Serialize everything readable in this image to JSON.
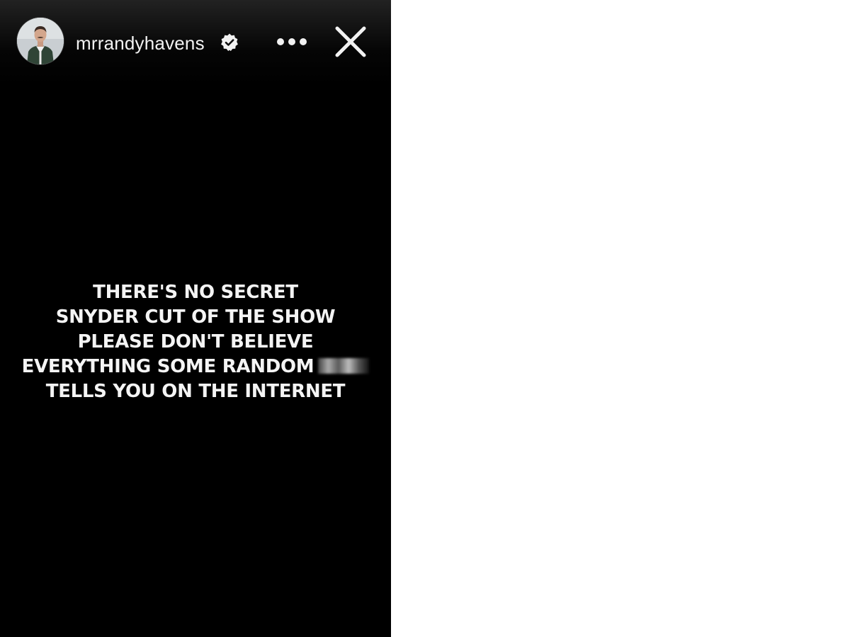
{
  "story": {
    "username": "mrrandyhavens",
    "verified": true,
    "header_icons": {
      "verified": "verified-badge-icon",
      "more": "more-options-icon",
      "close": "close-icon"
    },
    "text_lines": [
      "THERE'S NO SECRET",
      "SNYDER CUT OF THE SHOW",
      "PLEASE DON'T BELIEVE",
      "EVERYTHING SOME RANDOM",
      "TELLS YOU ON THE INTERNET"
    ],
    "colors": {
      "background": "#000000",
      "text": "#f4f4f4"
    }
  }
}
